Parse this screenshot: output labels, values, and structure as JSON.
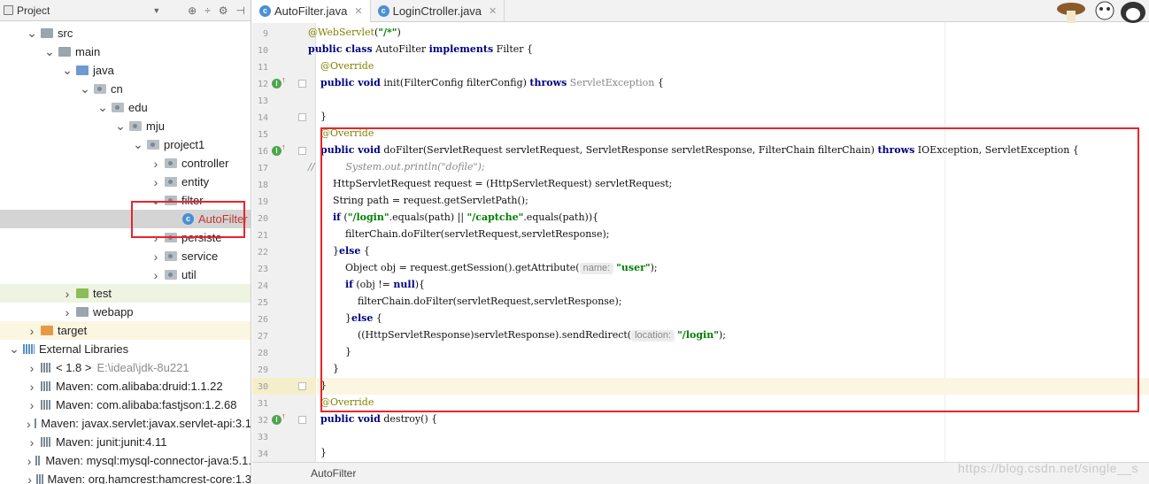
{
  "project_panel": {
    "title": "Project",
    "tree": [
      {
        "label": "src",
        "depth": 1,
        "icon": "folder-grey",
        "arrow": "expanded"
      },
      {
        "label": "main",
        "depth": 2,
        "icon": "folder-grey",
        "arrow": "expanded"
      },
      {
        "label": "java",
        "depth": 3,
        "icon": "folder-blue",
        "arrow": "expanded"
      },
      {
        "label": "cn",
        "depth": 4,
        "icon": "package",
        "arrow": "expanded"
      },
      {
        "label": "edu",
        "depth": 5,
        "icon": "package",
        "arrow": "expanded"
      },
      {
        "label": "mju",
        "depth": 6,
        "icon": "package",
        "arrow": "expanded"
      },
      {
        "label": "project1",
        "depth": 7,
        "icon": "package",
        "arrow": "expanded"
      },
      {
        "label": "controller",
        "depth": 8,
        "icon": "package",
        "arrow": "collapsed"
      },
      {
        "label": "entity",
        "depth": 8,
        "icon": "package",
        "arrow": "collapsed"
      },
      {
        "label": "filter",
        "depth": 8,
        "icon": "package",
        "arrow": "expanded"
      },
      {
        "label": "AutoFilter",
        "depth": 9,
        "icon": "class",
        "arrow": "none",
        "selected": true
      },
      {
        "label": "persiste",
        "depth": 8,
        "icon": "package",
        "arrow": "collapsed"
      },
      {
        "label": "service",
        "depth": 8,
        "icon": "package",
        "arrow": "collapsed"
      },
      {
        "label": "util",
        "depth": 8,
        "icon": "package",
        "arrow": "collapsed"
      },
      {
        "label": "test",
        "depth": 3,
        "icon": "folder-green",
        "arrow": "collapsed"
      },
      {
        "label": "webapp",
        "depth": 3,
        "icon": "folder-grey",
        "arrow": "collapsed"
      },
      {
        "label": "target",
        "depth": 1,
        "icon": "folder-orange",
        "arrow": "collapsed"
      },
      {
        "label": "External Libraries",
        "depth": 0,
        "icon": "library",
        "arrow": "expanded"
      },
      {
        "label": "< 1.8 >",
        "depth": 1,
        "icon": "jar",
        "arrow": "collapsed",
        "extra": "E:\\ideal\\jdk-8u221"
      },
      {
        "label": "Maven: com.alibaba:druid:1.1.22",
        "depth": 1,
        "icon": "jar",
        "arrow": "collapsed"
      },
      {
        "label": "Maven: com.alibaba:fastjson:1.2.68",
        "depth": 1,
        "icon": "jar",
        "arrow": "collapsed"
      },
      {
        "label": "Maven: javax.servlet:javax.servlet-api:3.1",
        "depth": 1,
        "icon": "jar",
        "arrow": "collapsed"
      },
      {
        "label": "Maven: junit:junit:4.11",
        "depth": 1,
        "icon": "jar",
        "arrow": "collapsed"
      },
      {
        "label": "Maven: mysql:mysql-connector-java:5.1.",
        "depth": 1,
        "icon": "jar",
        "arrow": "collapsed"
      },
      {
        "label": "Maven: org.hamcrest:hamcrest-core:1.3",
        "depth": 1,
        "icon": "jar",
        "arrow": "collapsed"
      }
    ]
  },
  "tabs": [
    {
      "label": "AutoFilter.java",
      "active": true
    },
    {
      "label": "LoginCtroller.java",
      "active": false
    }
  ],
  "editor": {
    "lines": [
      {
        "n": "9",
        "html": "<span class=\"ann\">@WebServlet</span>(<span class=\"str\">\"/*\"</span>)"
      },
      {
        "n": "10",
        "html": "<span class=\"kw\">public class</span> AutoFilter <span class=\"kw\">implements</span> Filter {"
      },
      {
        "n": "11",
        "html": "    <span class=\"ann\">@Override</span>"
      },
      {
        "n": "12",
        "html": "    <span class=\"kw\">public void</span> init(FilterConfig filterConfig) <span class=\"kw\">throws</span> <span style=\"color:#888\">ServletException</span> {"
      },
      {
        "n": "13",
        "html": ""
      },
      {
        "n": "14",
        "html": "    }"
      },
      {
        "n": "15",
        "html": "    <span class=\"ann\">@Override</span>"
      },
      {
        "n": "16",
        "html": "    <span class=\"kw\">public void</span> doFilter(ServletRequest servletRequest, ServletResponse servletResponse, FilterChain filterChain) <span class=\"kw\">throws</span> IOException, ServletException {"
      },
      {
        "n": "17",
        "html": "<span class=\"cmt\">//          System.out.println(\"dofile\");</span>"
      },
      {
        "n": "18",
        "html": "        HttpServletRequest request = (HttpServletRequest) servletRequest;"
      },
      {
        "n": "19",
        "html": "        String path = request.getServletPath();"
      },
      {
        "n": "20",
        "html": "        <span class=\"kw\">if</span> (<span class=\"str\">\"/login\"</span>.equals(path) || <span class=\"str\">\"/captche\"</span>.equals(path)){"
      },
      {
        "n": "21",
        "html": "            filterChain.doFilter(servletRequest,servletResponse);"
      },
      {
        "n": "22",
        "html": "        }<span class=\"kw\">else</span> {"
      },
      {
        "n": "23",
        "html": "            Object obj = request.getSession().getAttribute(<span class=\"hint\">name:</span><span class=\"str\">\"user\"</span>);"
      },
      {
        "n": "24",
        "html": "            <span class=\"kw\">if</span> (obj != <span class=\"kw\">null</span>){"
      },
      {
        "n": "25",
        "html": "                filterChain.doFilter(servletRequest,servletResponse);"
      },
      {
        "n": "26",
        "html": "            }<span class=\"kw\">else</span> {"
      },
      {
        "n": "27",
        "html": "                ((HttpServletResponse)servletResponse).sendRedirect(<span class=\"hint\">location:</span><span class=\"str\">\"/login\"</span>);"
      },
      {
        "n": "28",
        "html": "            }"
      },
      {
        "n": "29",
        "html": "        }"
      },
      {
        "n": "30",
        "html": "    }"
      },
      {
        "n": "31",
        "html": "    <span class=\"ann\">@Override</span>"
      },
      {
        "n": "32",
        "html": "    <span class=\"kw\">public void</span> destroy() {"
      },
      {
        "n": "33",
        "html": ""
      },
      {
        "n": "34",
        "html": "    }"
      }
    ]
  },
  "status": {
    "breadcrumb": "AutoFilter"
  },
  "watermark": "https://blog.csdn.net/single__s",
  "colors": {
    "highlight_box": "#e8252b",
    "keyword": "#000080",
    "string": "#008000",
    "annotation": "#808000"
  }
}
